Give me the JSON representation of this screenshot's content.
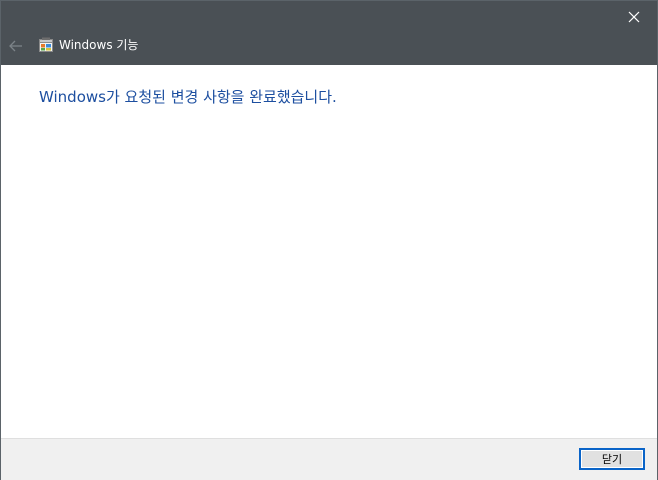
{
  "window": {
    "title": "Windows 기능",
    "icon": "windows-features-icon",
    "close_icon": "close-icon",
    "back_icon": "back-arrow-icon"
  },
  "main": {
    "message": "Windows가 요청된 변경 사항을 완료했습니다."
  },
  "footer": {
    "close_label": "닫기"
  },
  "colors": {
    "titlebar": "#4a5055",
    "message_text": "#1d4fa0",
    "footer": "#f0f0f0",
    "button_focus_border": "#0a64c8"
  }
}
